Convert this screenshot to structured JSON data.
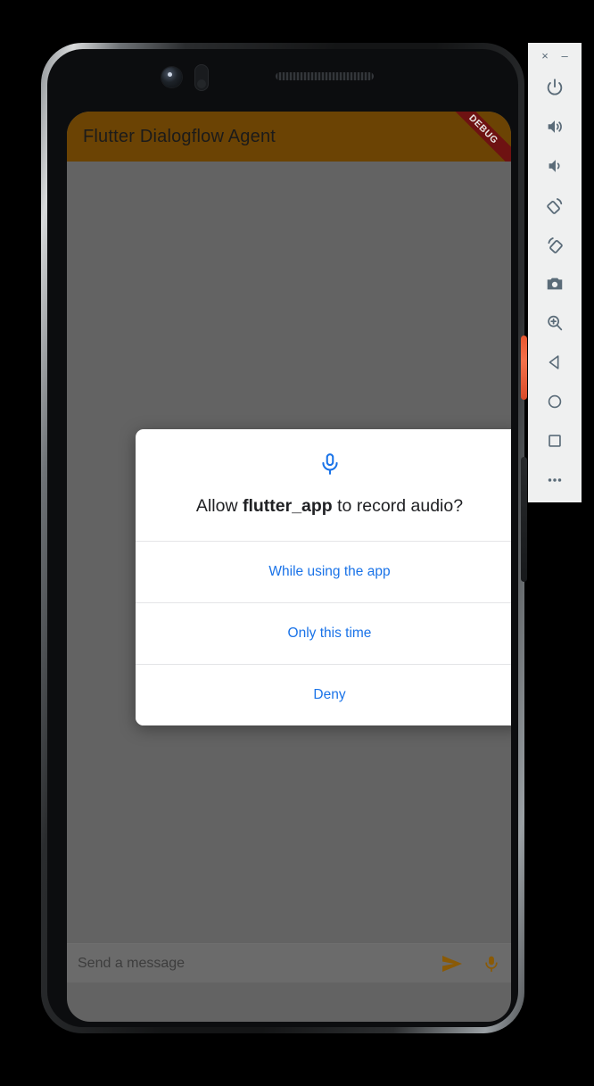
{
  "app": {
    "title": "Flutter Dialogflow Agent",
    "debug_banner": "DEBUG",
    "appbar_color": "#6b4304",
    "scrim_color": "#636363"
  },
  "dialog": {
    "icon": "microphone-icon",
    "icon_color": "#1a73e8",
    "message_prefix": "Allow ",
    "message_app_name": "flutter_app",
    "message_suffix": " to record audio?",
    "options": [
      {
        "label": "While using the app",
        "name": "while-using-the-app"
      },
      {
        "label": "Only this time",
        "name": "only-this-time"
      },
      {
        "label": "Deny",
        "name": "deny"
      }
    ],
    "option_color": "#1a73e8"
  },
  "message_bar": {
    "placeholder": "Send a message",
    "send_icon": "send-icon",
    "mic_icon": "microphone-icon",
    "icon_color": "#8a5a06"
  },
  "emulator_toolbar": {
    "window_buttons": [
      {
        "label": "×",
        "name": "close-window-button"
      },
      {
        "label": "–",
        "name": "minimize-window-button"
      }
    ],
    "items": [
      {
        "name": "power-icon",
        "label": "Power"
      },
      {
        "name": "volume-up-icon",
        "label": "Volume Up"
      },
      {
        "name": "volume-down-icon",
        "label": "Volume Down"
      },
      {
        "name": "rotate-left-icon",
        "label": "Rotate Left"
      },
      {
        "name": "rotate-right-icon",
        "label": "Rotate Right"
      },
      {
        "name": "camera-icon",
        "label": "Take Screenshot"
      },
      {
        "name": "zoom-icon",
        "label": "Enter Zoom Mode"
      },
      {
        "name": "back-icon",
        "label": "Back"
      },
      {
        "name": "home-icon",
        "label": "Home"
      },
      {
        "name": "overview-icon",
        "label": "Overview"
      },
      {
        "name": "more-icon",
        "label": "More"
      }
    ],
    "panel_color": "#eff0f0",
    "icon_color": "#5a6b78"
  }
}
